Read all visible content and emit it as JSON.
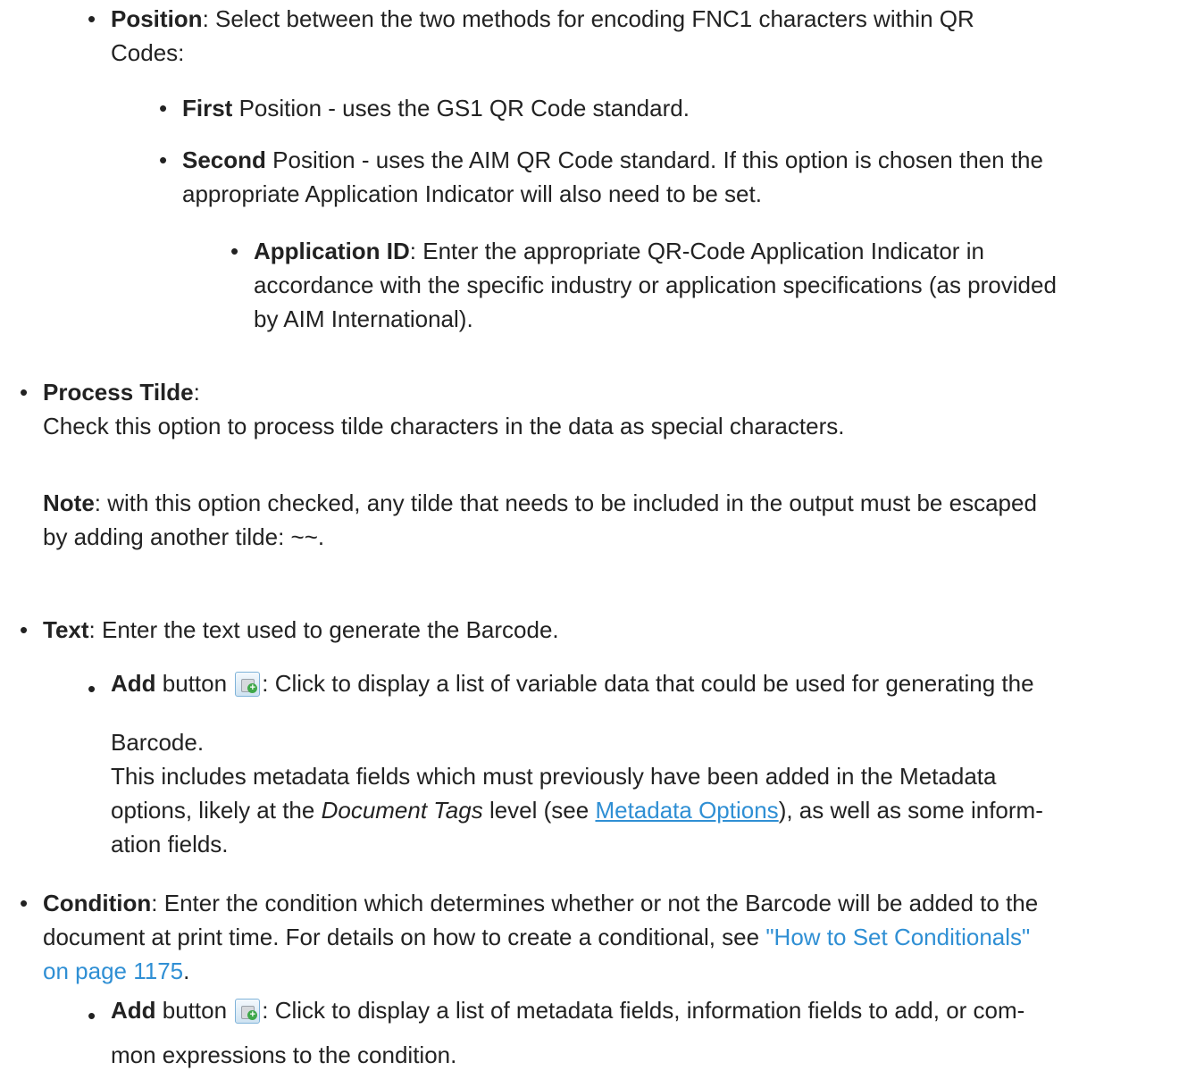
{
  "position": {
    "term": "Position",
    "desc_line1": ": Select between the two methods for encoding FNC1 characters within QR",
    "desc_line2": "Codes:",
    "first": {
      "term": "First",
      "desc": " Position - uses the GS1 QR Code standard."
    },
    "second": {
      "term": "Second",
      "desc_line1": " Position - uses the AIM QR Code standard. If this option is chosen then the",
      "desc_line2": "appropriate Application Indicator will also need to be set.",
      "application_id": {
        "term": "Application ID",
        "line1": ": Enter the appropriate QR-Code Application Indicator in",
        "line2": "accordance with the specific industry or application specifications (as provided",
        "line3": "by AIM International)."
      }
    }
  },
  "process_tilde": {
    "term": "Process Tilde",
    "colon": ":",
    "desc": "Check this option to process tilde characters in the data as special characters.",
    "note_term": "Note",
    "note_line1": ": with this option checked, any tilde that needs to be included in the output must be escaped",
    "note_line2": "by adding another tilde: ~~."
  },
  "text": {
    "term": "Text",
    "desc": ": Enter the text used to generate the Barcode.",
    "add": {
      "term": "Add",
      "button_word": " button ",
      "icon": "add-database-icon",
      "desc_line1": ": Click to display a list of variable data that could be used for generating the",
      "desc_line2": "Barcode.",
      "desc_line3": "This includes metadata fields which must previously have been added in the Metadata",
      "desc_line4_pre": "options, likely at the ",
      "desc_line4_em": "Document Tags",
      "desc_line4_mid": " level (see ",
      "desc_line4_link": "Metadata Options",
      "desc_line4_post": "), as well as some inform-",
      "desc_line5": "ation fields."
    }
  },
  "condition": {
    "term": "Condition",
    "line1": ": Enter the condition which determines whether or not the Barcode will be added to the",
    "line2_pre": "document at print time. For details on how to create a conditional, see ",
    "line2_xref": "\"How to Set Conditionals\"",
    "line3_xref": "on page 1175",
    "line3_post": ".",
    "add": {
      "term": "Add",
      "button_word": " button ",
      "icon": "add-database-icon",
      "desc_line1": ": Click to display a list of metadata fields, information fields to add, or com-",
      "desc_line2": "mon expressions to the condition."
    }
  },
  "colors": {
    "text": "#222222",
    "link": "#2f8fd4",
    "background": "#ffffff"
  }
}
